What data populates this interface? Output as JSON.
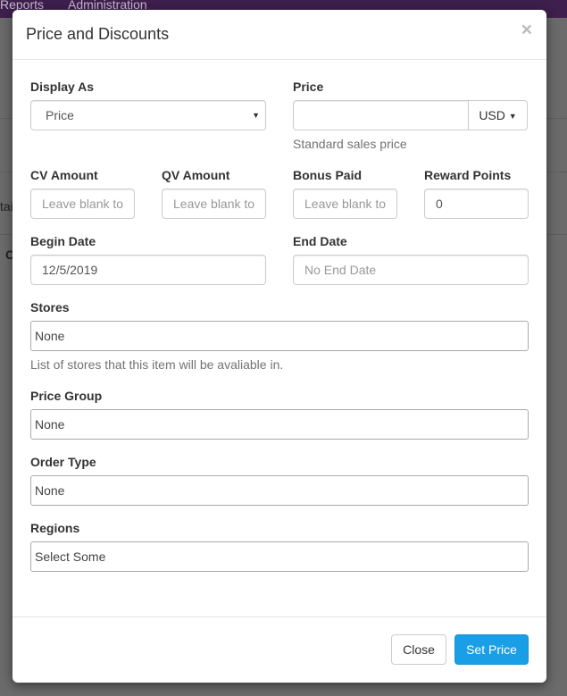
{
  "background": {
    "nav_items": [
      "Reports",
      "Administration"
    ],
    "fragments": [
      "tai",
      "C"
    ]
  },
  "modal": {
    "title": "Price and Discounts",
    "close_glyph": "×",
    "display_as": {
      "label": "Display As",
      "value": "Price"
    },
    "price": {
      "label": "Price",
      "value": "",
      "currency": "USD",
      "help": "Standard sales price"
    },
    "cv_amount": {
      "label": "CV Amount",
      "placeholder": "Leave blank to"
    },
    "qv_amount": {
      "label": "QV Amount",
      "placeholder": "Leave blank to"
    },
    "bonus_paid": {
      "label": "Bonus Paid",
      "placeholder": "Leave blank to"
    },
    "reward_points": {
      "label": "Reward Points",
      "value": "0"
    },
    "begin_date": {
      "label": "Begin Date",
      "value": "12/5/2019"
    },
    "end_date": {
      "label": "End Date",
      "placeholder": "No End Date"
    },
    "stores": {
      "label": "Stores",
      "value": "None",
      "help": "List of stores that this item will be avaliable in."
    },
    "price_group": {
      "label": "Price Group",
      "value": "None"
    },
    "order_type": {
      "label": "Order Type",
      "value": "None"
    },
    "regions": {
      "label": "Regions",
      "value": "Select Some"
    },
    "footer": {
      "close_label": "Close",
      "submit_label": "Set Price"
    }
  },
  "colors": {
    "primary": "#1a9ee6",
    "navbar": "#3e1f4d"
  }
}
